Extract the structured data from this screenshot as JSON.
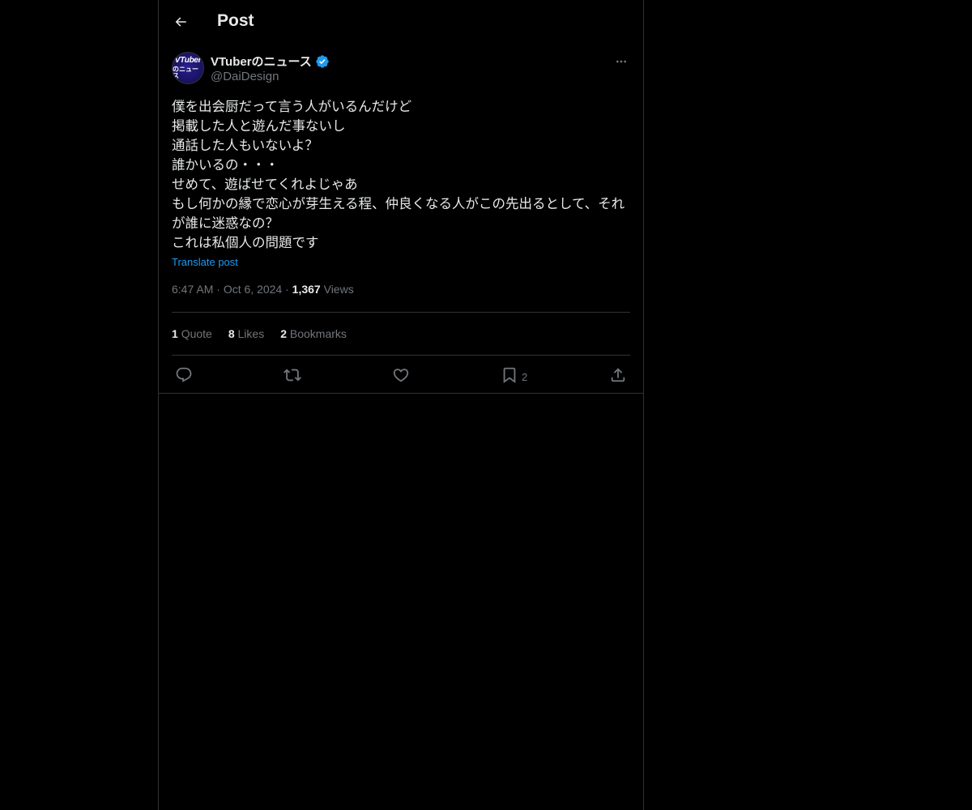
{
  "header": {
    "title": "Post",
    "back_icon": "arrow-left-icon"
  },
  "author": {
    "display_name": "VTuberのニュース",
    "handle": "@DaiDesign",
    "avatar_line1": "VTuber",
    "avatar_line2": "のニュース",
    "verified": true,
    "verified_color": "#1d9bf0"
  },
  "post": {
    "text": "僕を出会厨だって言う人がいるんだけど\n掲載した人と遊んだ事ないし\n通話した人もいないよ？\n誰かいるの・・・\nせめて、遊ばせてくれよじゃあ\nもし何かの縁で恋心が芽生える程、仲良くなる人がこの先出るとして、それが誰に迷惑なの？\nこれは私個人の問題です",
    "translate_label": "Translate post",
    "time": "6:47 AM",
    "date": "Oct 6, 2024",
    "views_count": "1,367",
    "views_label": "Views"
  },
  "stats": {
    "quotes_count": "1",
    "quotes_label": "Quote",
    "likes_count": "8",
    "likes_label": "Likes",
    "bookmarks_count": "2",
    "bookmarks_label": "Bookmarks"
  },
  "actions": {
    "reply_icon": "reply-icon",
    "repost_icon": "repost-icon",
    "like_icon": "heart-icon",
    "bookmark_icon": "bookmark-icon",
    "bookmark_count": "2",
    "share_icon": "share-icon"
  },
  "colors": {
    "background": "#000000",
    "text": "#e7e9ea",
    "muted": "#71767b",
    "accent": "#1d9bf0",
    "border": "#2f3336"
  }
}
